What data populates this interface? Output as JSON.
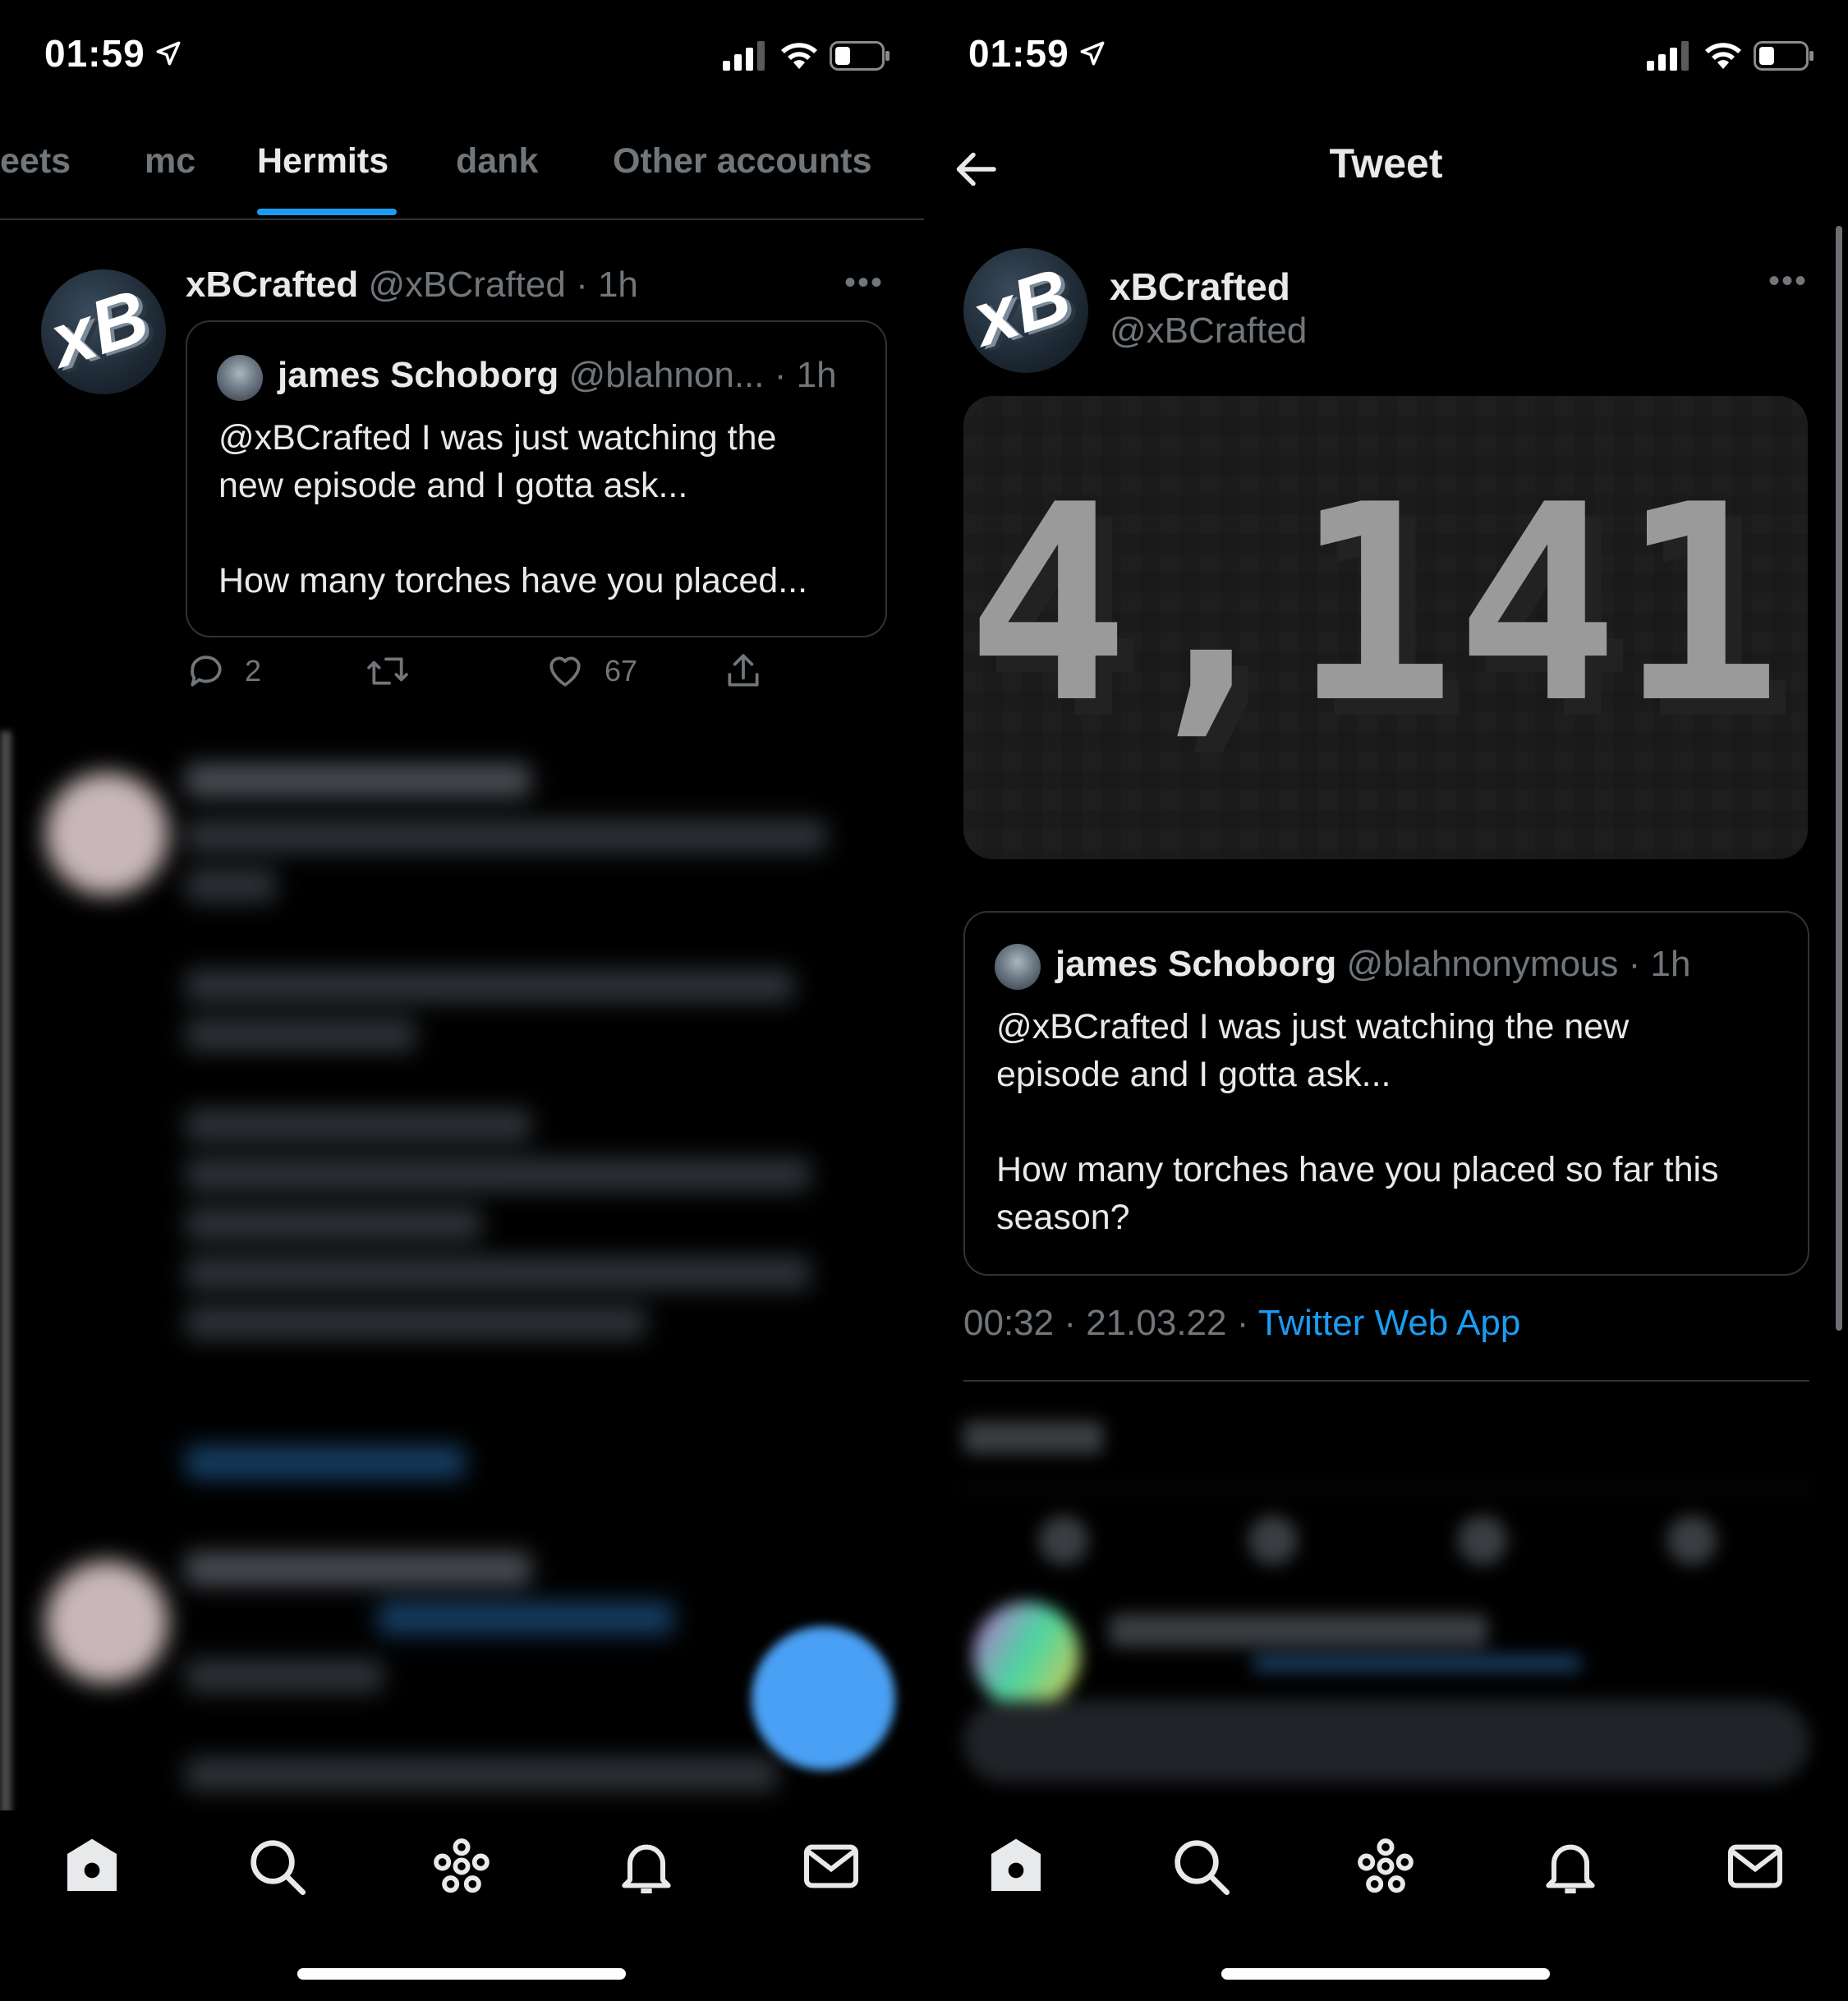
{
  "status_bar": {
    "time": "01:59"
  },
  "left": {
    "tabs": [
      {
        "label": "eets"
      },
      {
        "label": "mc"
      },
      {
        "label": "Hermits",
        "active": true
      },
      {
        "label": "dank"
      },
      {
        "label": "Other accounts"
      }
    ],
    "tweet": {
      "author_name": "xBCrafted",
      "author_handle": "@xBCrafted",
      "time": "· 1h",
      "avatar_text": "xB",
      "quote": {
        "name": "james Schoborg",
        "handle": "@blahnon...",
        "time": "· 1h",
        "text": "@xBCrafted I was just watching the new episode and I gotta ask...",
        "text2": "How many torches have you placed..."
      },
      "replies": "2",
      "likes": "67"
    }
  },
  "right": {
    "header_title": "Tweet",
    "tweet": {
      "author_name": "xBCrafted",
      "author_handle": "@xBCrafted",
      "avatar_text": "xB",
      "media_text": "4,141",
      "quote": {
        "name": "james Schoborg",
        "handle": "@blahnonymous",
        "time": "· 1h",
        "text_line1": "@xBCrafted I was just watching the new",
        "text_line2": "episode and I gotta ask...",
        "text_line3": "How many torches have you placed so far this",
        "text_line4": "season?"
      },
      "timestamp": "00:32 · 21.03.22 · ",
      "source": "Twitter Web App"
    }
  },
  "colors": {
    "accent": "#1d9bf0",
    "muted": "#71767b",
    "text": "#e7e9ea",
    "border": "#2f3336"
  },
  "icons": {
    "nav": [
      "home-icon",
      "search-icon",
      "spaces-icon",
      "notifications-icon",
      "messages-icon"
    ],
    "tweet_actions": [
      "reply-icon",
      "retweet-icon",
      "like-icon",
      "share-icon"
    ]
  }
}
